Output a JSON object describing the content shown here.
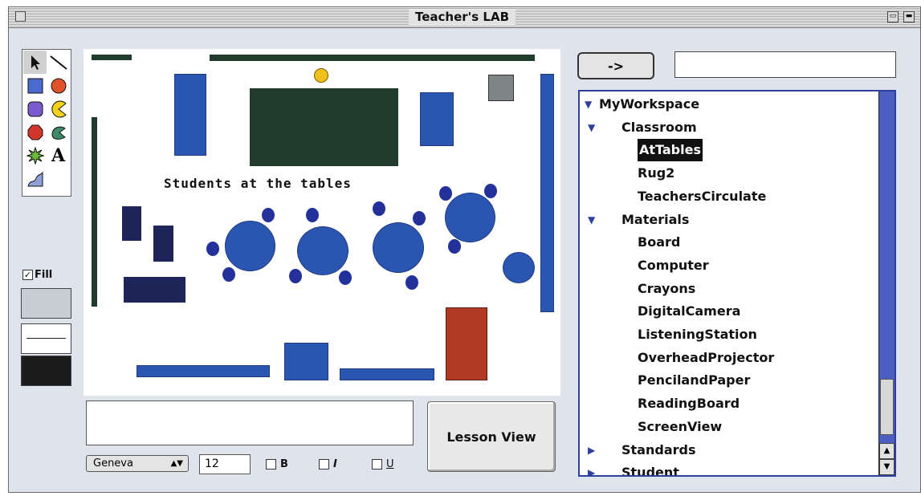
{
  "window": {
    "title": "Teacher's LAB"
  },
  "canvas": {
    "caption": "Students at the tables"
  },
  "fill": {
    "label": "Fill",
    "checked": true
  },
  "font_controls": {
    "font": "Geneva",
    "size": "12",
    "bold_label": "B",
    "italic_label": "I",
    "underline_label": "U"
  },
  "buttons": {
    "lesson_view": "Lesson View",
    "go": "->"
  },
  "tree": {
    "items": [
      {
        "label": "MyWorkspace",
        "level": 0,
        "expanded": true
      },
      {
        "label": "Classroom",
        "level": 1,
        "expanded": true
      },
      {
        "label": "AtTables",
        "level": 2,
        "selected": true
      },
      {
        "label": "Rug2",
        "level": 2
      },
      {
        "label": "TeachersCirculate",
        "level": 2
      },
      {
        "label": "Materials",
        "level": 1,
        "expanded": true
      },
      {
        "label": "Board",
        "level": 2
      },
      {
        "label": "Computer",
        "level": 2
      },
      {
        "label": "Crayons",
        "level": 2
      },
      {
        "label": "DigitalCamera",
        "level": 2
      },
      {
        "label": "ListeningStation",
        "level": 2
      },
      {
        "label": "OverheadProjector",
        "level": 2
      },
      {
        "label": "PencilandPaper",
        "level": 2
      },
      {
        "label": "ReadingBoard",
        "level": 2
      },
      {
        "label": "ScreenView",
        "level": 2
      },
      {
        "label": "Standards",
        "level": 1,
        "expanded": false
      },
      {
        "label": "Student",
        "level": 1,
        "expanded": false
      }
    ]
  },
  "colors": {
    "furniture_blue": "#2a55b0",
    "board_green": "#213b2d",
    "navy": "#1f2558",
    "rug_red": "#b23a22",
    "tree_accent": "#2e3f9e"
  }
}
